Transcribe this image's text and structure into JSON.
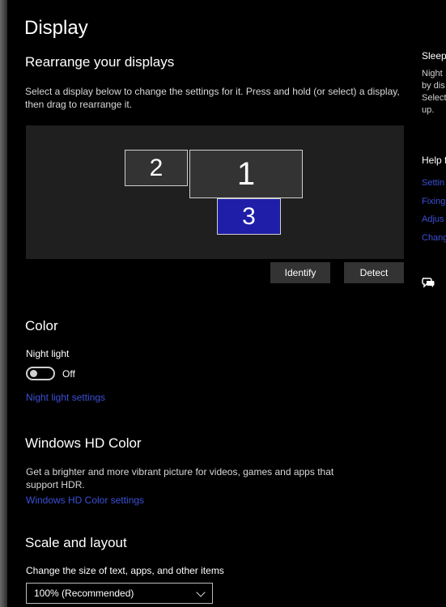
{
  "page": {
    "title": "Display"
  },
  "arrange": {
    "title": "Rearrange your displays",
    "description": "Select a display below to change the settings for it. Press and hold (or select) a display, then drag to rearrange it.",
    "monitors": [
      {
        "label": "2",
        "selected": false
      },
      {
        "label": "1",
        "selected": false
      },
      {
        "label": "3",
        "selected": true
      }
    ],
    "identify_label": "Identify",
    "detect_label": "Detect"
  },
  "color": {
    "title": "Color",
    "night_light_label": "Night light",
    "night_light_state": "Off",
    "night_light_link": "Night light settings"
  },
  "hdr": {
    "title": "Windows HD Color",
    "description": "Get a brighter and more vibrant picture for videos, games and apps that support HDR.",
    "link": "Windows HD Color settings"
  },
  "scale": {
    "title": "Scale and layout",
    "size_label": "Change the size of text, apps, and other items",
    "size_value": "100% (Recommended)"
  },
  "right_panel": {
    "sleep_title": "Sleep",
    "sleep_lines": [
      "Night",
      "by dis",
      "Select",
      "up."
    ],
    "help_title": "Help f",
    "help_links": [
      "Settin",
      "Fixing",
      "Adjus",
      "Chang"
    ],
    "feedback_icon": "feedback-icon"
  },
  "colors": {
    "accent_link": "#3b50d6",
    "selected_display": "#1e1ea8",
    "background": "#000000"
  }
}
